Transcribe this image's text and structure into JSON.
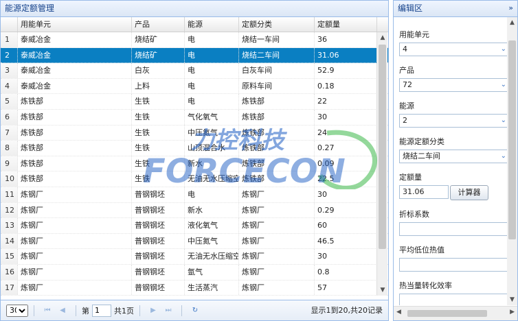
{
  "left_panel": {
    "title": "能源定额管理"
  },
  "grid": {
    "columns": [
      "",
      "用能单元",
      "产品",
      "能源",
      "定额分类",
      "定额量"
    ],
    "rows": [
      [
        "1",
        "泰威冶金",
        "烧结矿",
        "电",
        "烧结一车间",
        "36"
      ],
      [
        "2",
        "泰威冶金",
        "烧结矿",
        "电",
        "烧结二车间",
        "31.06"
      ],
      [
        "3",
        "泰威冶金",
        "白灰",
        "电",
        "白灰车间",
        "52.9"
      ],
      [
        "4",
        "泰威冶金",
        "上料",
        "电",
        "原料车间",
        "0.18"
      ],
      [
        "5",
        "炼铁部",
        "生铁",
        "电",
        "炼铁部",
        "22"
      ],
      [
        "6",
        "炼铁部",
        "生铁",
        "气化氧气",
        "炼铁部",
        "30"
      ],
      [
        "7",
        "炼铁部",
        "生铁",
        "中压氮气",
        "炼铁部",
        "24"
      ],
      [
        "8",
        "炼铁部",
        "生铁",
        "山顶混合水",
        "炼铁部",
        "0.27"
      ],
      [
        "9",
        "炼铁部",
        "生铁",
        "新水",
        "炼铁部",
        "0.09"
      ],
      [
        "10",
        "炼铁部",
        "生铁",
        "无油无水压缩空",
        "炼铁部",
        "22.5"
      ],
      [
        "11",
        "炼钢厂",
        "普钢钢坯",
        "电",
        "炼钢厂",
        "30"
      ],
      [
        "12",
        "炼钢厂",
        "普钢钢坯",
        "新水",
        "炼钢厂",
        "0.29"
      ],
      [
        "13",
        "炼钢厂",
        "普钢钢坯",
        "液化氧气",
        "炼钢厂",
        "60"
      ],
      [
        "14",
        "炼钢厂",
        "普钢钢坯",
        "中压氮气",
        "炼钢厂",
        "46.5"
      ],
      [
        "15",
        "炼钢厂",
        "普钢钢坯",
        "无油无水压缩空",
        "炼钢厂",
        "30"
      ],
      [
        "16",
        "炼钢厂",
        "普钢钢坯",
        "氩气",
        "炼钢厂",
        "0.8"
      ],
      [
        "17",
        "炼钢厂",
        "普钢钢坯",
        "生活蒸汽",
        "炼钢厂",
        "57"
      ]
    ],
    "selected_row": 1
  },
  "pager": {
    "page_size": "30",
    "page_prefix": "第",
    "page_number": "1",
    "page_suffix": "共1页",
    "info": "显示1到20,共20记录"
  },
  "right_panel": {
    "title": "编辑区",
    "fields": {
      "unit_label": "用能单元",
      "unit_value": "4",
      "product_label": "产品",
      "product_value": "72",
      "energy_label": "能源",
      "energy_value": "2",
      "class_label": "能源定额分类",
      "class_value": "烧结二车间",
      "quota_label": "定额量",
      "quota_value": "31.06",
      "calc_button": "计算器",
      "coef_label": "折标系数",
      "coef_value": "",
      "heat_label": "平均低位热值",
      "heat_value": "",
      "eff_label": "热当量转化效率",
      "eff_value": ""
    }
  },
  "watermark": {
    "top_text": "力控科技",
    "bottom_text": "FORCECON"
  },
  "colors": {
    "selected": "#0a7fc2",
    "header_text": "#15428b",
    "border": "#99bbe8",
    "watermark_blue": "#1f5fc4",
    "watermark_green": "#3cb848"
  }
}
